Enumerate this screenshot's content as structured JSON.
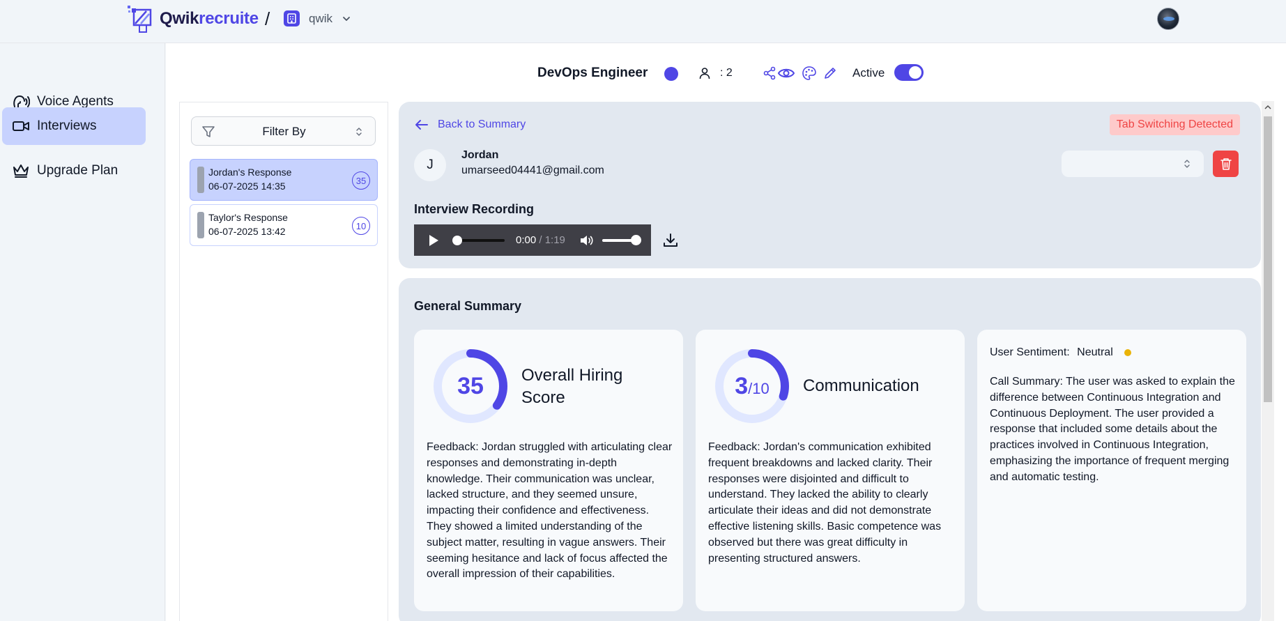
{
  "brand": {
    "part1": "Qwik",
    "part2": "recruite"
  },
  "header": {
    "separator": "/",
    "org_name": "qwik"
  },
  "sidebar": {
    "items": [
      {
        "label": "Voice Agents",
        "icon": "voice-agent-icon"
      },
      {
        "label": "Interviews",
        "icon": "video-icon",
        "active": true
      },
      {
        "label": "Upgrade Plan",
        "icon": "crown-icon"
      }
    ]
  },
  "job": {
    "title": "DevOps Engineer",
    "candidates_count": ": 2",
    "status_label": "Active",
    "status_on": true,
    "accent_color": "#4f46e5"
  },
  "filter": {
    "label": "Filter By"
  },
  "responses": [
    {
      "name": "Jordan's Response",
      "date": "06-07-2025 14:35",
      "score": "35",
      "selected": true
    },
    {
      "name": "Taylor's Response",
      "date": "06-07-2025 13:42",
      "score": "10",
      "selected": false
    }
  ],
  "detail": {
    "back_label": "Back to Summary",
    "warning": "Tab Switching Detected",
    "candidate_initial": "J",
    "candidate_name": "Jordan",
    "candidate_email": "umarseed04441@gmail.com",
    "status_select_value": "",
    "recording_title": "Interview Recording",
    "player": {
      "current": "0:00",
      "duration": "/ 1:19",
      "progress": 0,
      "volume": 1
    }
  },
  "summary": {
    "title": "General Summary",
    "hiring": {
      "score": "35",
      "score_fraction": 0.35,
      "title": "Overall Hiring Score",
      "feedback": "Feedback: Jordan struggled with articulating clear responses and demonstrating in-depth knowledge. Their communication was unclear, lacked structure, and they seemed unsure, impacting their confidence and effectiveness. They showed a limited understanding of the subject matter, resulting in vague answers. Their seeming hesitance and lack of focus affected the overall impression of their capabilities."
    },
    "communication": {
      "score": "3",
      "out_of": "/10",
      "score_fraction": 0.3,
      "title": "Communication",
      "feedback": "Feedback: Jordan's communication exhibited frequent breakdowns and lacked clarity. Their responses were disjointed and difficult to understand. They lacked the ability to clearly articulate their ideas and did not demonstrate effective listening skills. Basic competence was observed but there was great difficulty in presenting structured answers."
    },
    "sentiment": {
      "label": "User Sentiment:",
      "value": "Neutral",
      "color": "#eab308",
      "call_summary": "Call Summary: The user was asked to explain the difference between Continuous Integration and Continuous Deployment. The user provided a response that included some details about the practices involved in Continuous Integration, emphasizing the importance of frequent merging and automatic testing."
    }
  }
}
